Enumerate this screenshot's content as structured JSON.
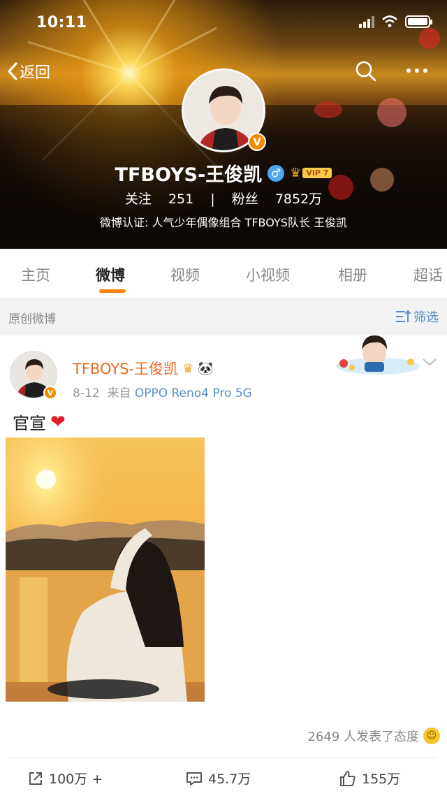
{
  "status_bar": {
    "time": "10:11"
  },
  "nav": {
    "back_label": "返回"
  },
  "profile": {
    "name": "TFBOYS-王俊凯",
    "vip_level": "VIP 7",
    "following_label": "关注",
    "following_count": "251",
    "separator": "|",
    "followers_label": "粉丝",
    "followers_count": "7852万",
    "verification": "微博认证: 人气少年偶像组合 TFBOYS队长 王俊凯",
    "verified_badge": "V"
  },
  "tabs": [
    {
      "label": "主页"
    },
    {
      "label": "微博"
    },
    {
      "label": "视频"
    },
    {
      "label": "小视频"
    },
    {
      "label": "相册"
    },
    {
      "label": "超话"
    }
  ],
  "filter_bar": {
    "label": "原创微博",
    "filter_label": "筛选"
  },
  "post": {
    "author": "TFBOYS-王俊凯",
    "date": "8-12",
    "source_prefix": "来自",
    "device": "OPPO Reno4 Pro 5G",
    "text": "官宣",
    "reactions_text": "2649 人发表了态度",
    "repost_count": "100万 +",
    "comment_count": "45.7万",
    "like_count": "155万"
  },
  "colors": {
    "accent": "#ff8200",
    "author": "#e86b21",
    "link": "#5b8dc8",
    "verified": "#f08c00"
  },
  "icons": {
    "back": "chevron-left-icon",
    "search": "search-icon",
    "more": "more-horizontal-icon",
    "filter": "filter-icon",
    "chevron": "chevron-down-icon",
    "repost": "share-icon",
    "comment": "comment-icon",
    "like": "thumbs-up-icon",
    "heart": "heart-icon"
  }
}
